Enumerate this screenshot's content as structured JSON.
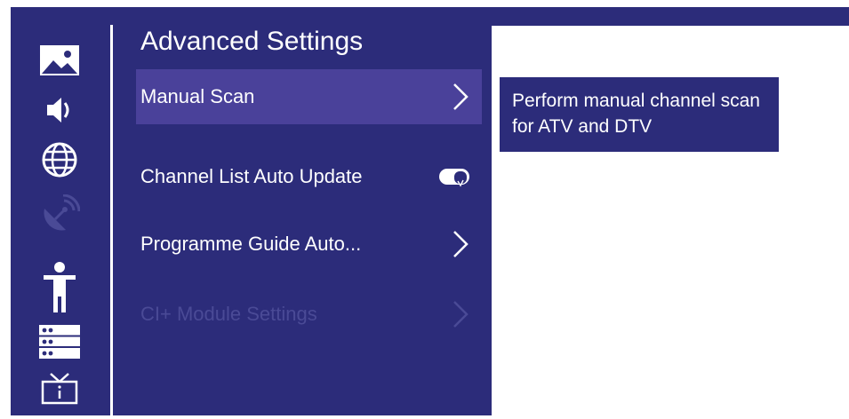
{
  "panel": {
    "title": "Advanced Settings"
  },
  "sidebar": {
    "icons": [
      {
        "name": "picture-icon"
      },
      {
        "name": "sound-icon"
      },
      {
        "name": "network-globe-icon"
      },
      {
        "name": "satellite-icon",
        "disabled": true
      },
      {
        "name": "accessibility-icon"
      },
      {
        "name": "system-icon"
      },
      {
        "name": "tv-channel-icon"
      }
    ]
  },
  "menu": {
    "items": [
      {
        "label": "Manual Scan",
        "selected": true,
        "control": "chevron"
      },
      {
        "label": "Channel List Auto Update",
        "control": "toggle",
        "toggle_on": true
      },
      {
        "label": "Programme Guide Auto...",
        "control": "chevron"
      },
      {
        "label": "CI+ Module Settings",
        "disabled": true,
        "control": "chevron"
      }
    ]
  },
  "help": {
    "text": "Perform manual channel scan for ATV and DTV"
  },
  "colors": {
    "background": "#2c2c7a",
    "selection": "#4a419a",
    "disabled_text": "#4a4a96",
    "foreground": "#ffffff"
  }
}
